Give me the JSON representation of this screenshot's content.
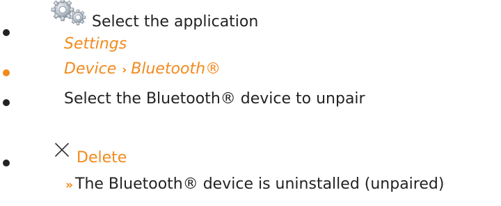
{
  "steps": [
    {
      "icon": "settings-gear-icon",
      "text": "Select the application",
      "link": "Settings"
    },
    {
      "path": [
        "Device",
        "Bluetooth®"
      ],
      "separator": "›"
    },
    {
      "text": "Select the Bluetooth® device to unpair"
    },
    {
      "icon": "delete-x-icon",
      "action": "Delete",
      "result_marker": "››",
      "result": "The Bluetooth® device is uninstalled (unpaired)"
    }
  ],
  "colors": {
    "accent": "#f28a1c",
    "text": "#222222"
  }
}
